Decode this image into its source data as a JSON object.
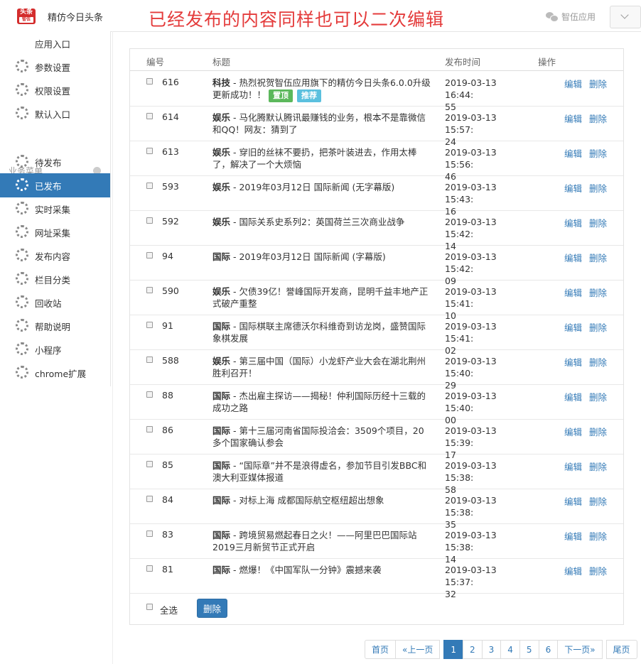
{
  "header": {
    "logo_text": "头条",
    "logo_sub": "智伍",
    "app_title": "精仿今日头条",
    "banner": "已经发布的内容同样也可以二次编辑",
    "account": "智伍应用"
  },
  "sidebar": {
    "items": [
      {
        "label": "应用入口",
        "icon": "chat-icon"
      },
      {
        "label": "参数设置",
        "icon": "gear-icon"
      },
      {
        "label": "权限设置",
        "icon": "gear-icon"
      },
      {
        "label": "默认入口",
        "icon": "gear-icon"
      }
    ],
    "section_label": "业务菜单",
    "biz_items": [
      {
        "label": "待发布"
      },
      {
        "label": "已发布",
        "active": true
      },
      {
        "label": "实时采集"
      },
      {
        "label": "网址采集"
      },
      {
        "label": "发布内容"
      },
      {
        "label": "栏目分类"
      },
      {
        "label": "回收站"
      },
      {
        "label": "帮助说明"
      },
      {
        "label": "小程序"
      },
      {
        "label": "chrome扩展"
      }
    ]
  },
  "table": {
    "headers": {
      "id": "编号",
      "title": "标题",
      "time": "发布时间",
      "actions": "操作"
    },
    "edit_label": "编辑",
    "delete_label": "删除",
    "rows": [
      {
        "id": "616",
        "category": "科技",
        "text": "热烈祝贺智伍应用旗下的精仿今日头条6.0.0升级更新成功！！",
        "tags": [
          "置顶",
          "推荐"
        ],
        "time_a": "2019-03-13 16:44:",
        "time_b": "55"
      },
      {
        "id": "614",
        "category": "娱乐",
        "text": "马化腾默认腾讯最赚钱的业务，根本不是靠微信和QQ！网友：猜到了",
        "tags": [],
        "time_a": "2019-03-13 15:57:",
        "time_b": "24"
      },
      {
        "id": "613",
        "category": "娱乐",
        "text": "穿旧的丝袜不要扔，把茶叶装进去，作用太棒了，解决了一个大烦恼",
        "tags": [],
        "time_a": "2019-03-13 15:56:",
        "time_b": "46"
      },
      {
        "id": "593",
        "category": "娱乐",
        "text": "2019年03月12日 国际新闻 (无字幕版)",
        "tags": [],
        "time_a": "2019-03-13 15:43:",
        "time_b": "16"
      },
      {
        "id": "592",
        "category": "娱乐",
        "text": "国际关系史系列2：英国荷兰三次商业战争",
        "tags": [],
        "time_a": "2019-03-13 15:42:",
        "time_b": "14"
      },
      {
        "id": "94",
        "category": "国际",
        "text": "2019年03月12日 国际新闻 (字幕版)",
        "tags": [],
        "time_a": "2019-03-13 15:42:",
        "time_b": "09"
      },
      {
        "id": "590",
        "category": "娱乐",
        "text": "欠债39亿！誉峰国际开发商，昆明千益丰地产正式破产重整",
        "tags": [],
        "time_a": "2019-03-13 15:41:",
        "time_b": "10"
      },
      {
        "id": "91",
        "category": "国际",
        "text": "国际棋联主席德沃尔科维奇到访龙岗，盛赞国际象棋发展",
        "tags": [],
        "time_a": "2019-03-13 15:41:",
        "time_b": "02"
      },
      {
        "id": "588",
        "category": "娱乐",
        "text": "第三届中国（国际）小龙虾产业大会在湖北荆州胜利召开！",
        "tags": [],
        "time_a": "2019-03-13 15:40:",
        "time_b": "29"
      },
      {
        "id": "88",
        "category": "国际",
        "text": "杰出雇主探访——揭秘！仲利国际历经十三载的成功之路",
        "tags": [],
        "time_a": "2019-03-13 15:40:",
        "time_b": "00"
      },
      {
        "id": "86",
        "category": "国际",
        "text": "第十三届河南省国际投洽会：3509个项目，20多个国家确认参会",
        "tags": [],
        "time_a": "2019-03-13 15:39:",
        "time_b": "17"
      },
      {
        "id": "85",
        "category": "国际",
        "text": "“国际章”并不是浪得虚名，参加节目引发BBC和澳大利亚媒体报道",
        "tags": [],
        "time_a": "2019-03-13 15:38:",
        "time_b": "58"
      },
      {
        "id": "84",
        "category": "国际",
        "text": "对标上海 成都国际航空枢纽超出想象",
        "tags": [],
        "time_a": "2019-03-13 15:38:",
        "time_b": "35"
      },
      {
        "id": "83",
        "category": "国际",
        "text": "跨境贸易燃起春日之火！——阿里巴巴国际站2019三月新贸节正式开启",
        "tags": [],
        "time_a": "2019-03-13 15:38:",
        "time_b": "14"
      },
      {
        "id": "81",
        "category": "国际",
        "text": "燃爆！《中国军队一分钟》震撼来袭",
        "tags": [],
        "time_a": "2019-03-13 15:37:",
        "time_b": "32"
      }
    ],
    "select_all_label": "全选",
    "bulk_delete_label": "删除"
  },
  "pagination": {
    "first": "首页",
    "prev": "«上一页",
    "pages": [
      "1",
      "2",
      "3",
      "4",
      "5",
      "6"
    ],
    "current": "1",
    "next": "下一页»",
    "last": "尾页"
  },
  "colors": {
    "primary": "#337ab7",
    "banner_red": "#e43b3b",
    "tag_top": "#5cb85c",
    "tag_recommend": "#5bc0de"
  }
}
